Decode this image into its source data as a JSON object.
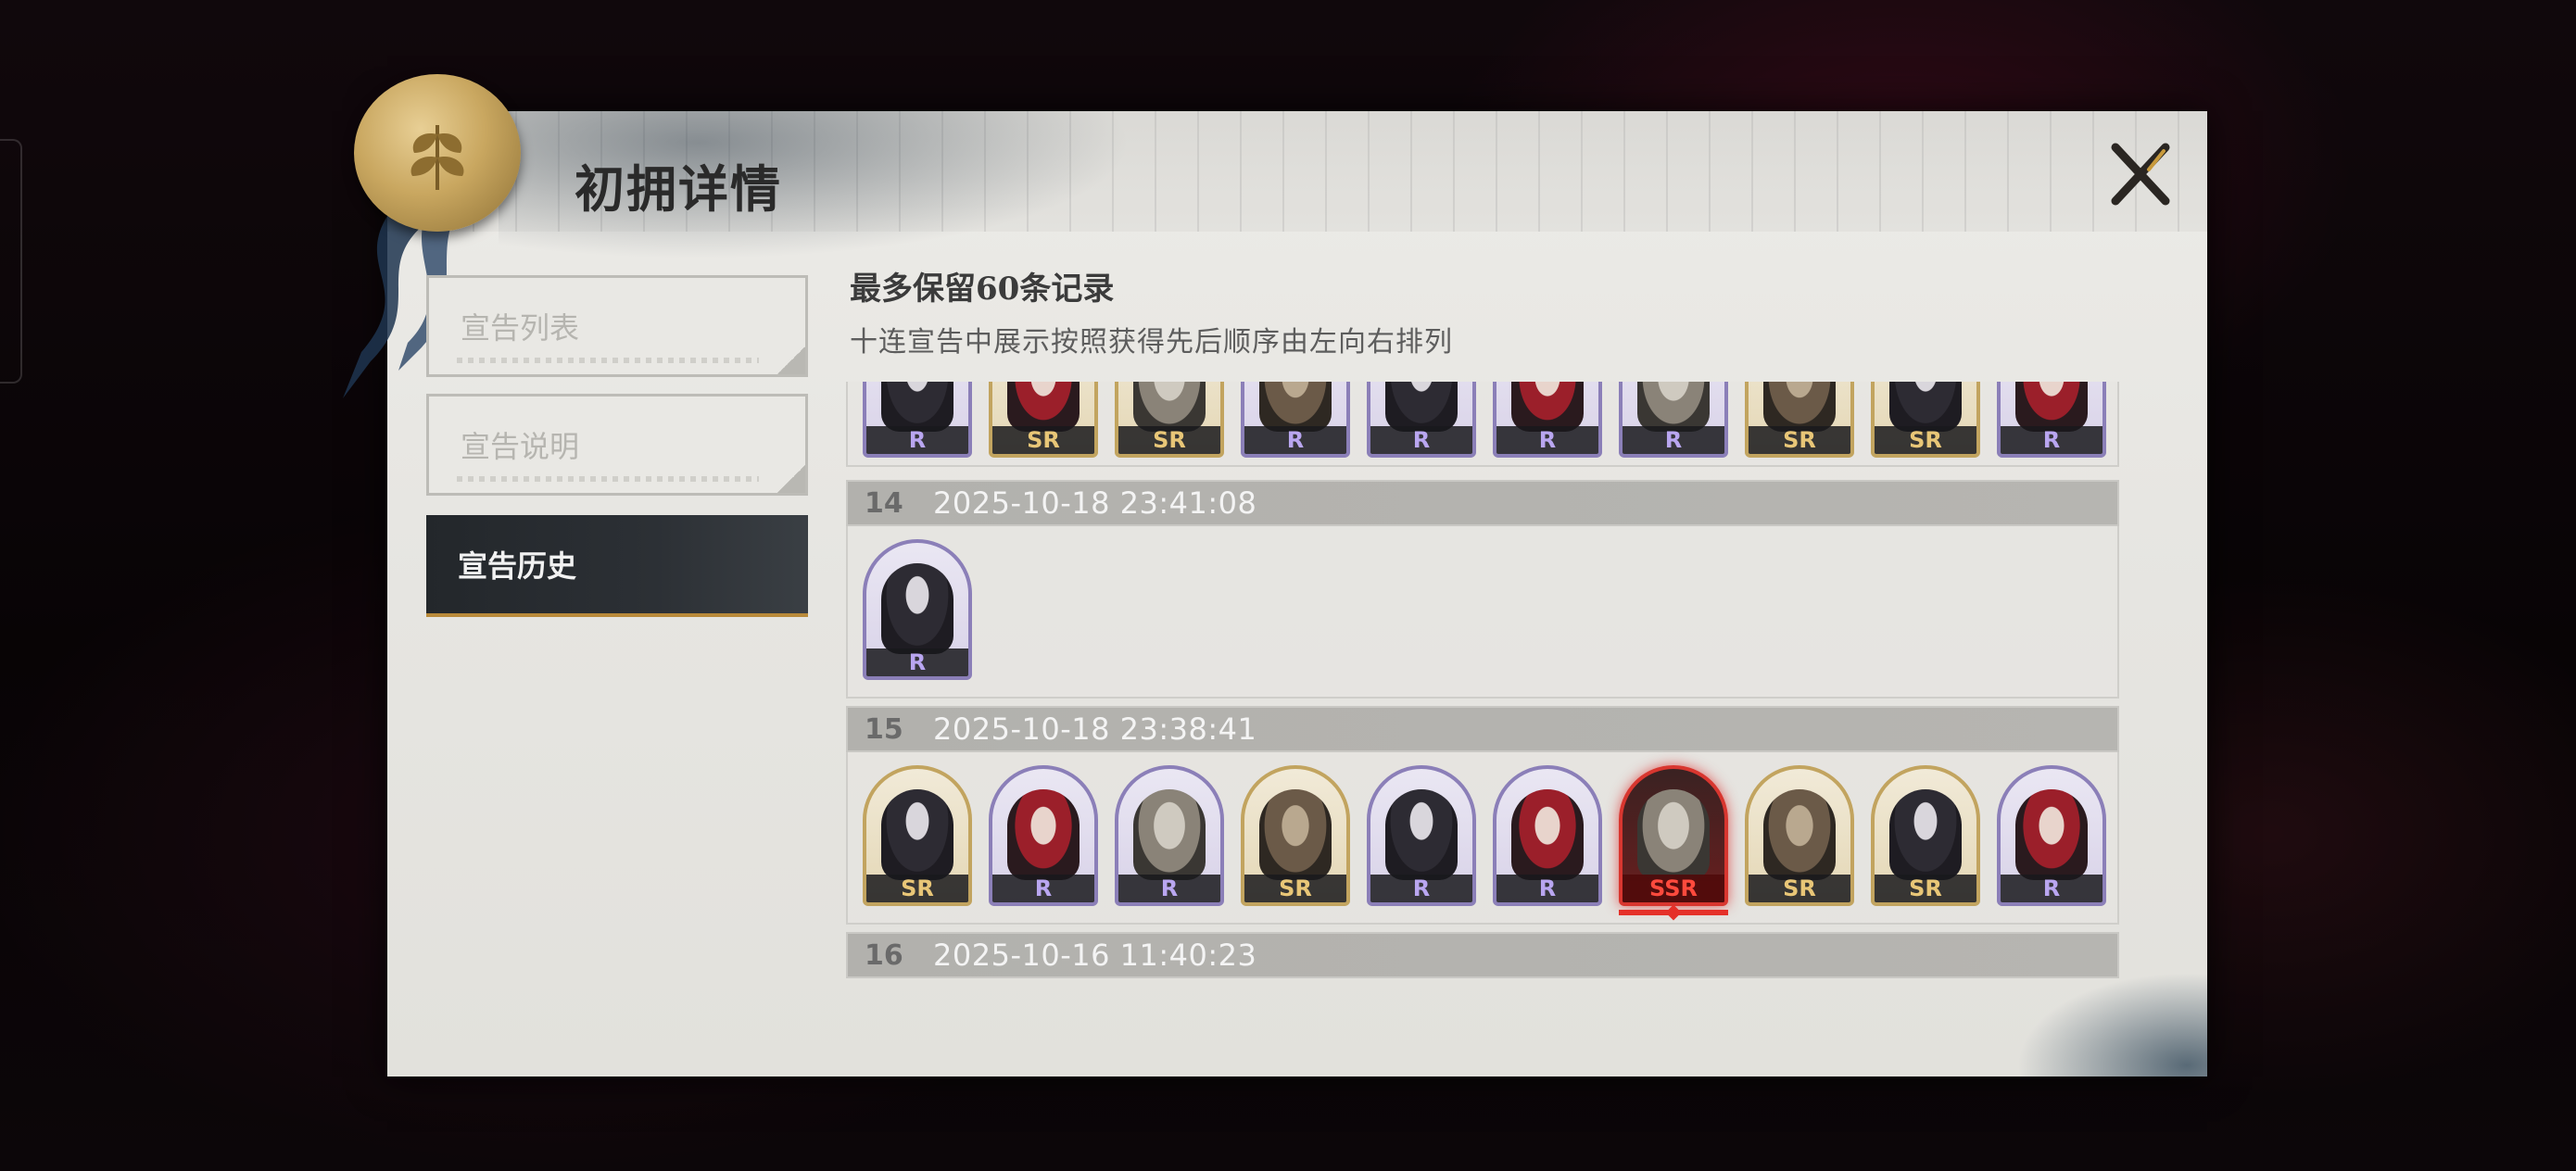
{
  "dialog": {
    "title": "初拥详情",
    "close_icon": "close-x-icon"
  },
  "nav": {
    "items": [
      {
        "label": "宣告列表",
        "active": false
      },
      {
        "label": "宣告说明",
        "active": false
      },
      {
        "label": "宣告历史",
        "active": true
      }
    ]
  },
  "info": {
    "title": "最多保留60条记录",
    "subtitle": "十连宣告中展示按照获得先后顺序由左向右排列"
  },
  "records": [
    {
      "index": "",
      "time": "",
      "cards": [
        "R",
        "SR",
        "SR",
        "R",
        "R",
        "R",
        "R",
        "SR",
        "SR",
        "R"
      ]
    },
    {
      "index": "14",
      "time": "2025-10-18 23:41:08",
      "cards": [
        "R"
      ]
    },
    {
      "index": "15",
      "time": "2025-10-18 23:38:41",
      "cards": [
        "SR",
        "R",
        "R",
        "SR",
        "R",
        "R",
        "SSR",
        "SR",
        "SR",
        "R"
      ]
    },
    {
      "index": "16",
      "time": "2025-10-16 11:40:23",
      "cards": []
    }
  ],
  "colors": {
    "R": "#8b7fb8",
    "SR": "#c2a45f",
    "SSR": "#d8362f"
  }
}
